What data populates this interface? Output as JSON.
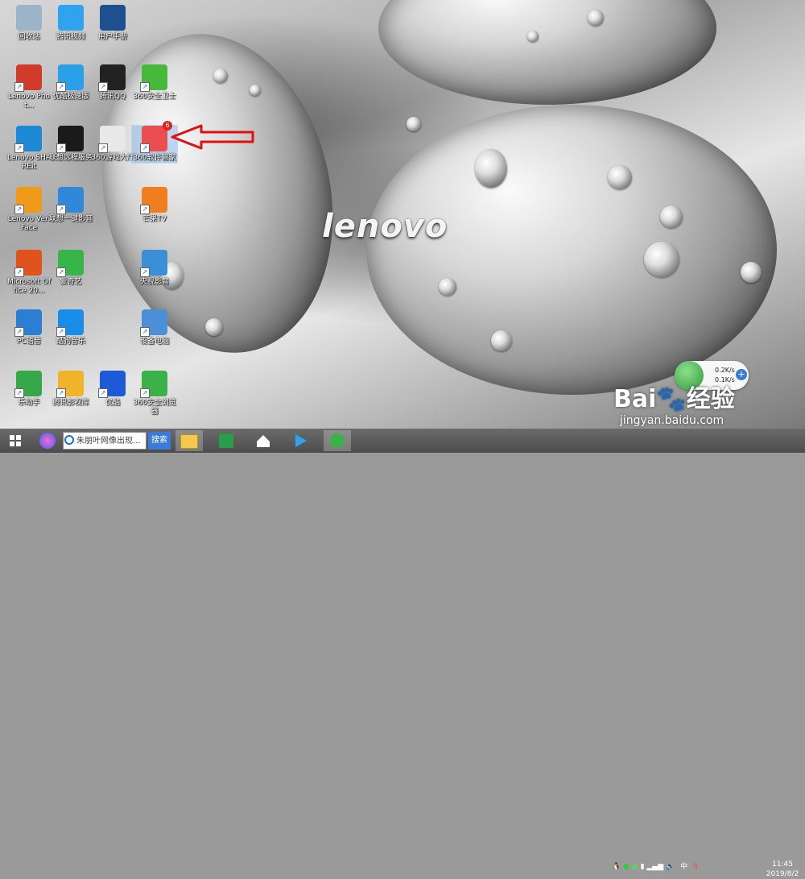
{
  "desktop": {
    "wallpaper_logo": "lenovo",
    "icons": [
      {
        "label": "回收站",
        "icon": "recycle-bin-icon",
        "color": "#9cb4c8"
      },
      {
        "label": "腾讯视频",
        "icon": "tencent-video-icon",
        "color": "#2fa3f0"
      },
      {
        "label": "用户手册",
        "icon": "user-manual-icon",
        "color": "#1e4f8f"
      },
      {
        "label": "Lenovo Phot...",
        "icon": "lenovo-photo-icon",
        "color": "#d23b2a"
      },
      {
        "label": "优酷极速版",
        "icon": "youku-exp-icon",
        "color": "#29a0e8"
      },
      {
        "label": "腾讯QQ",
        "icon": "qq-icon",
        "color": "#222222"
      },
      {
        "label": "360安全卫士",
        "icon": "360-security-icon",
        "color": "#46b83a"
      },
      {
        "label": "Lenovo SHAREit",
        "icon": "shareit-icon",
        "color": "#1e8ad6"
      },
      {
        "label": "联想远程服务",
        "icon": "lenovo-remote-icon",
        "color": "#1a1a1a"
      },
      {
        "label": "360游戏大厅",
        "icon": "360-game-icon",
        "color": "#e8e8e8"
      },
      {
        "label": "360软件管家",
        "icon": "360-software-manager-icon",
        "color": "#e94f4f",
        "badge": "6"
      },
      {
        "label": "Lenovo VeriFace",
        "icon": "veriface-icon",
        "color": "#f09a1a"
      },
      {
        "label": "联想一键影音",
        "icon": "lenovo-media-icon",
        "color": "#2f88d8"
      },
      {
        "label": "芒果TV",
        "icon": "mango-tv-icon",
        "color": "#f07e1e"
      },
      {
        "label": "Microsoft Office 20...",
        "icon": "office-icon",
        "color": "#e0531f"
      },
      {
        "label": "爱奇艺",
        "icon": "iqiyi-icon",
        "color": "#37b44a"
      },
      {
        "label": "央视影音",
        "icon": "cctv-icon",
        "color": "#3a8fd6"
      },
      {
        "label": "PC语音",
        "icon": "pc-voice-icon",
        "color": "#2a7fd4"
      },
      {
        "label": "酷狗音乐",
        "icon": "kugou-icon",
        "color": "#1a8de8"
      },
      {
        "label": "设备电脑",
        "icon": "this-pc-icon",
        "color": "#4a8fd8"
      },
      {
        "label": "乐助手",
        "icon": "le-helper-icon",
        "color": "#36a84a"
      },
      {
        "label": "腾讯影视库",
        "icon": "tencent-library-icon",
        "color": "#f0b42a"
      },
      {
        "label": "优酷",
        "icon": "youku-icon",
        "color": "#1e5ad8"
      },
      {
        "label": "360安全浏览器",
        "icon": "360-browser-icon",
        "color": "#3bb14a"
      }
    ]
  },
  "net_widget": {
    "up": "0.2K/s",
    "down": "0.1K/s"
  },
  "watermark": {
    "brand": "Bai",
    "brand2": "经验",
    "url": "jingyan.baidu.com"
  },
  "taskbar": {
    "search_placeholder": "朱朋叶网像出现...",
    "search_button": "搜索",
    "ime": "中",
    "time": "11:45",
    "date": "2019/8/2"
  }
}
